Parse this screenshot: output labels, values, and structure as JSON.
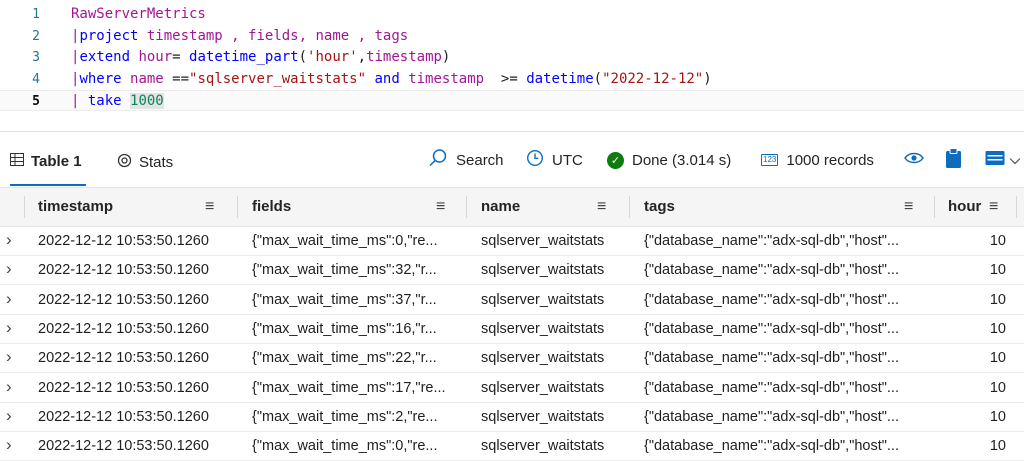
{
  "editor": {
    "line_numbers": [
      "1",
      "2",
      "3",
      "4",
      "5"
    ],
    "lines": [
      [
        {
          "t": "RawServerMetrics",
          "c": "t-table"
        }
      ],
      [
        {
          "t": "|",
          "c": "t-pipe"
        },
        {
          "t": "project",
          "c": "t-kw"
        },
        {
          "t": " timestamp , fields, name , tags",
          "c": "t-op"
        }
      ],
      [
        {
          "t": "|",
          "c": "t-pipe"
        },
        {
          "t": "extend",
          "c": "t-kw"
        },
        {
          "t": " hour",
          "c": "t-op"
        },
        {
          "t": "= ",
          "c": "t-id"
        },
        {
          "t": "datetime_part",
          "c": "t-fn"
        },
        {
          "t": "(",
          "c": "t-id"
        },
        {
          "t": "'hour'",
          "c": "t-str"
        },
        {
          "t": ",",
          "c": "t-id"
        },
        {
          "t": "timestamp",
          "c": "t-op"
        },
        {
          "t": ")",
          "c": "t-id"
        }
      ],
      [
        {
          "t": "|",
          "c": "t-pipe"
        },
        {
          "t": "where",
          "c": "t-kw"
        },
        {
          "t": " name ",
          "c": "t-op"
        },
        {
          "t": "==",
          "c": "t-id"
        },
        {
          "t": "\"sqlserver_waitstats\"",
          "c": "t-str"
        },
        {
          "t": " and ",
          "c": "t-kw"
        },
        {
          "t": "timestamp",
          "c": "t-op"
        },
        {
          "t": "  >= ",
          "c": "t-id"
        },
        {
          "t": "datetime",
          "c": "t-fn"
        },
        {
          "t": "(",
          "c": "t-id"
        },
        {
          "t": "\"2022-12-12\"",
          "c": "t-str"
        },
        {
          "t": ")",
          "c": "t-id"
        }
      ],
      [
        {
          "t": "| ",
          "c": "t-pipe"
        },
        {
          "t": "take",
          "c": "t-kw"
        },
        {
          "t": " ",
          "c": "t-id"
        },
        {
          "t": "1000",
          "c": "t-num hl"
        }
      ]
    ]
  },
  "toolbar": {
    "tab_table": "Table 1",
    "tab_stats": "Stats",
    "search": "Search",
    "timezone": "UTC",
    "status": "Done (3.014 s)",
    "records_badge": "123",
    "records": "1000 records"
  },
  "grid": {
    "columns": [
      "timestamp",
      "fields",
      "name",
      "tags",
      "hour"
    ],
    "rows": [
      {
        "timestamp": "2022-12-12 10:53:50.1260",
        "fields": "{\"max_wait_time_ms\":0,\"re...",
        "name": "sqlserver_waitstats",
        "tags": "{\"database_name\":\"adx-sql-db\",\"host\"...",
        "hour": "10"
      },
      {
        "timestamp": "2022-12-12 10:53:50.1260",
        "fields": "{\"max_wait_time_ms\":32,\"r...",
        "name": "sqlserver_waitstats",
        "tags": "{\"database_name\":\"adx-sql-db\",\"host\"...",
        "hour": "10"
      },
      {
        "timestamp": "2022-12-12 10:53:50.1260",
        "fields": "{\"max_wait_time_ms\":37,\"r...",
        "name": "sqlserver_waitstats",
        "tags": "{\"database_name\":\"adx-sql-db\",\"host\"...",
        "hour": "10"
      },
      {
        "timestamp": "2022-12-12 10:53:50.1260",
        "fields": "{\"max_wait_time_ms\":16,\"r...",
        "name": "sqlserver_waitstats",
        "tags": "{\"database_name\":\"adx-sql-db\",\"host\"...",
        "hour": "10"
      },
      {
        "timestamp": "2022-12-12 10:53:50.1260",
        "fields": "{\"max_wait_time_ms\":22,\"r...",
        "name": "sqlserver_waitstats",
        "tags": "{\"database_name\":\"adx-sql-db\",\"host\"...",
        "hour": "10"
      },
      {
        "timestamp": "2022-12-12 10:53:50.1260",
        "fields": "{\"max_wait_time_ms\":17,\"re...",
        "name": "sqlserver_waitstats",
        "tags": "{\"database_name\":\"adx-sql-db\",\"host\"...",
        "hour": "10"
      },
      {
        "timestamp": "2022-12-12 10:53:50.1260",
        "fields": "{\"max_wait_time_ms\":2,\"re...",
        "name": "sqlserver_waitstats",
        "tags": "{\"database_name\":\"adx-sql-db\",\"host\"...",
        "hour": "10"
      },
      {
        "timestamp": "2022-12-12 10:53:50.1260",
        "fields": "{\"max_wait_time_ms\":0,\"re...",
        "name": "sqlserver_waitstats",
        "tags": "{\"database_name\":\"adx-sql-db\",\"host\"...",
        "hour": "10"
      }
    ]
  },
  "colors": {
    "accent": "#0f6cbd",
    "success": "#107c10",
    "line_number": "#237893"
  },
  "icons": [
    "table-icon",
    "stats-icon",
    "search-icon",
    "clock-icon",
    "done-icon",
    "records-icon",
    "eye-icon",
    "clipboard-icon",
    "layout-icon",
    "chevron-down-icon",
    "row-expand-icon",
    "column-menu-icon"
  ]
}
